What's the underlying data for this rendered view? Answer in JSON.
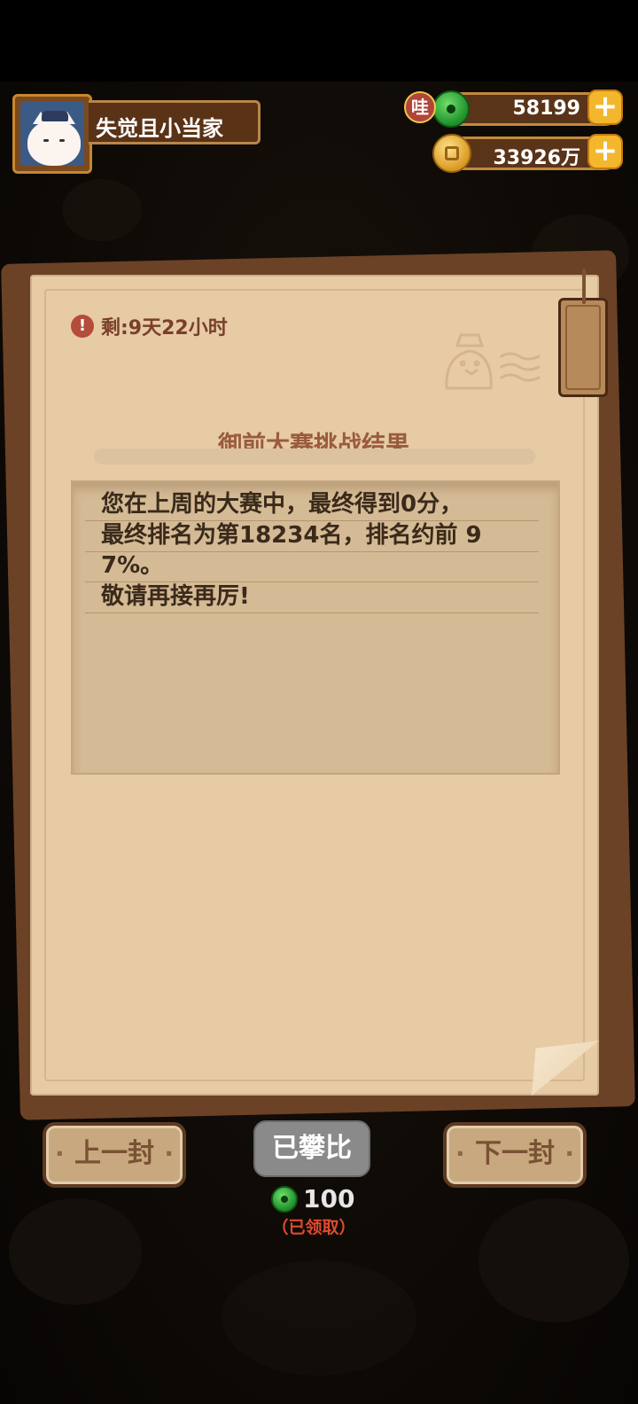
{
  "player": {
    "name": "失觉且小当家"
  },
  "currency": {
    "jade_badge": "哇",
    "jade_amount": "58199",
    "coin_amount": "33926万",
    "jade_plus": "+",
    "coin_plus": "+"
  },
  "letter": {
    "time_left": "剩:9天22小时",
    "title": "御前大赛挑战结果",
    "body_lines": [
      "您在上周的大赛中，最终得到0分，",
      "最终排名为第18234名，排名约前 9",
      "7%。",
      "敬请再接再厉!"
    ]
  },
  "buttons": {
    "prev": "上一封",
    "claimed": "已攀比",
    "next": "下一封"
  },
  "reward": {
    "amount": "100",
    "status": "（已领取）"
  },
  "colors": {
    "paper": "#e6cba5",
    "paper_back": "#6b4226",
    "title": "#9a5b3e",
    "warning": "#b44c3a",
    "claimed_status": "#e04a2e"
  },
  "icons": [
    "warning-icon",
    "jade-icon",
    "coin-icon",
    "plus-icon",
    "avatar",
    "duck-stamp-icon"
  ]
}
